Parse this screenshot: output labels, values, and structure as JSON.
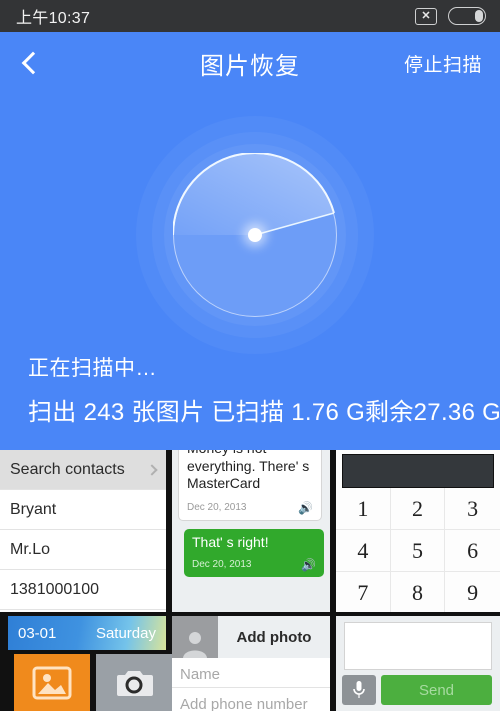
{
  "status_bar": {
    "time": "上午10:37",
    "icons": [
      {
        "name": "no-sim-icon",
        "glyph": "✕"
      },
      {
        "name": "battery-icon",
        "glyph": ""
      }
    ]
  },
  "header": {
    "back_icon": "chevron-left-icon",
    "title": "图片恢复",
    "action_label": "停止扫描"
  },
  "scanner": {
    "status_text": "正在扫描中…",
    "detail_text": "扫出 243 张图片 已扫描 1.76 G剩余27.36 G",
    "found_count": "243",
    "scanned_size": "1.76 G",
    "remaining_size": "27.36 G",
    "sweep_angle_deg": 195,
    "accent_color": "#4a86f7",
    "dial_color": "#ffffff"
  },
  "previews": {
    "contacts": {
      "search_label": "Search contacts",
      "rows": [
        {
          "label": "Bryant"
        },
        {
          "label": "Mr.Lo"
        },
        {
          "label": "1381000100"
        }
      ]
    },
    "chat": {
      "incoming": {
        "text": "Money is not everything. There' s MasterCard",
        "date": "Dec 20, 2013",
        "speaker_icon": "🔊"
      },
      "outgoing": {
        "text": "That' s right!",
        "date": "Dec 20, 2013",
        "speaker_icon": "🔊",
        "color": "#31a92c"
      }
    },
    "dialer": {
      "keys": [
        "1",
        "2",
        "3",
        "4",
        "5",
        "6",
        "7",
        "8",
        "9"
      ]
    },
    "date_widget": {
      "date": "03-01",
      "weekday": "Saturday"
    },
    "app_tiles": [
      {
        "name": "gallery-tile",
        "icon": "image-icon",
        "color": "#f08a1c"
      },
      {
        "name": "camera-tile",
        "icon": "camera-icon",
        "color": "#9aa0a6"
      }
    ],
    "add_contact": {
      "add_photo_label": "Add photo",
      "name_placeholder": "Name",
      "phone_placeholder": "Add phone number"
    },
    "composer": {
      "input_value": "",
      "mic_icon": "microphone-icon",
      "send_label": "Send"
    }
  }
}
